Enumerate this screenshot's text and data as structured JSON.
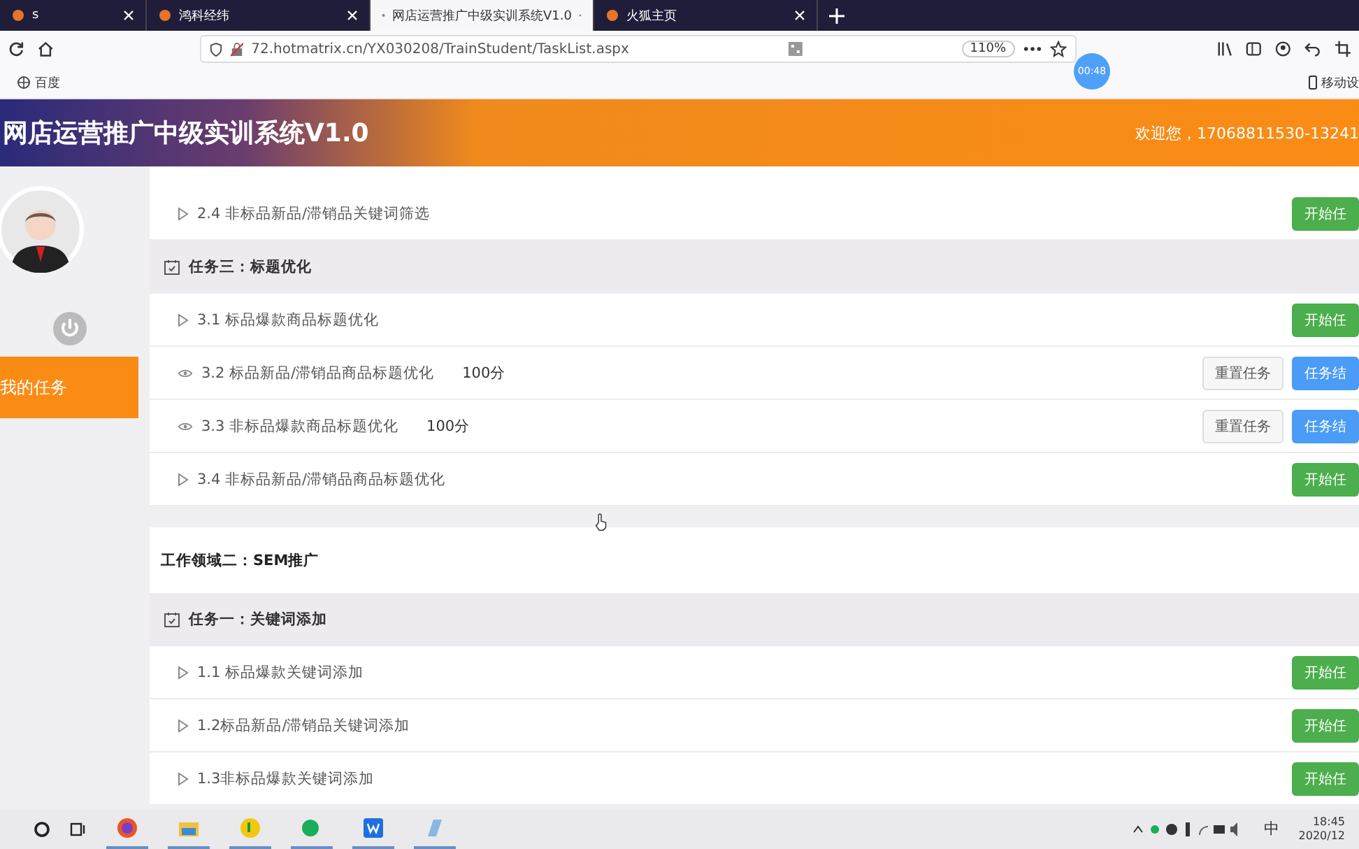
{
  "browser": {
    "tabs": [
      {
        "label": "s",
        "selected": false
      },
      {
        "label": "鸿科经纬",
        "selected": false
      },
      {
        "label": "网店运营推广中级实训系统V1.0",
        "selected": true
      },
      {
        "label": "火狐主页",
        "selected": false
      }
    ],
    "url": "72.hotmatrix.cn/YX030208/TrainStudent/TaskList.aspx",
    "zoom": "110%",
    "timer": "00:48",
    "bookmarks": [
      {
        "label": "百度"
      }
    ],
    "bookmark_right": "移动设"
  },
  "header": {
    "title": "网店运营推广中级实训系统V1.0",
    "welcome": "欢迎您，17068811530-13241"
  },
  "sidebar": {
    "items": [
      {
        "label": "我的任务",
        "selected": true
      }
    ]
  },
  "sections": [
    {
      "items": [
        {
          "kind": "subtask",
          "done": false,
          "label": "2.4 非标品新品/滞销品关键词筛选",
          "buttons": [
            {
              "kind": "start",
              "label": "开始任"
            }
          ]
        },
        {
          "kind": "task",
          "label": "任务三：标题优化"
        },
        {
          "kind": "subtask",
          "done": false,
          "label": "3.1 标品爆款商品标题优化",
          "buttons": [
            {
              "kind": "start",
              "label": "开始任"
            }
          ]
        },
        {
          "kind": "subtask",
          "done": true,
          "label": "3.2 标品新品/滞销品商品标题优化",
          "score": "100分",
          "buttons": [
            {
              "kind": "reset",
              "label": "重置任务"
            },
            {
              "kind": "result",
              "label": "任务结"
            }
          ]
        },
        {
          "kind": "subtask",
          "done": true,
          "label": "3.3 非标品爆款商品标题优化",
          "score": "100分",
          "buttons": [
            {
              "kind": "reset",
              "label": "重置任务"
            },
            {
              "kind": "result",
              "label": "任务结"
            }
          ]
        },
        {
          "kind": "subtask",
          "done": false,
          "label": "3.4 非标品新品/滞销品商品标题优化",
          "buttons": [
            {
              "kind": "start",
              "label": "开始任"
            }
          ]
        }
      ]
    },
    {
      "title": "工作领域二：SEM推广",
      "items": [
        {
          "kind": "task",
          "label": "任务一：关键词添加"
        },
        {
          "kind": "subtask",
          "done": false,
          "label": "1.1 标品爆款关键词添加",
          "buttons": [
            {
              "kind": "start",
              "label": "开始任"
            }
          ]
        },
        {
          "kind": "subtask",
          "done": false,
          "label": "1.2标品新品/滞销品关键词添加",
          "buttons": [
            {
              "kind": "start",
              "label": "开始任"
            }
          ]
        },
        {
          "kind": "subtask",
          "done": false,
          "label": "1.3非标品爆款关键词添加",
          "buttons": [
            {
              "kind": "start",
              "label": "开始任"
            }
          ]
        }
      ]
    }
  ],
  "taskbar": {
    "time": "18:45",
    "date": "2020/12",
    "ime": "中"
  }
}
